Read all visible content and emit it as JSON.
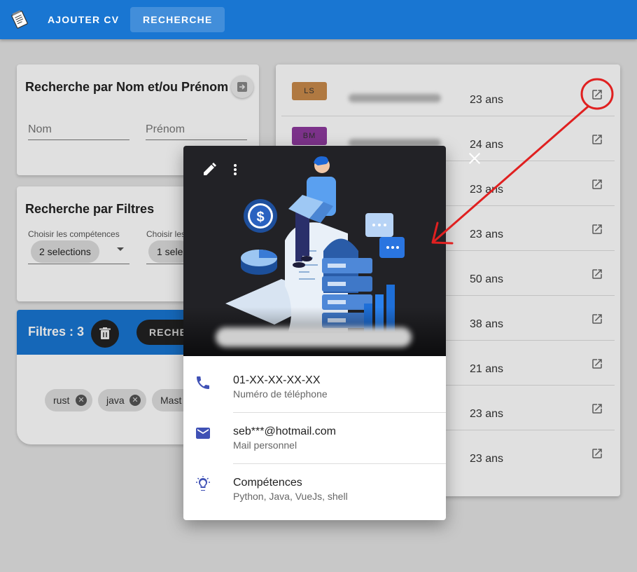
{
  "appbar": {
    "logo_icon": "notepad-icon",
    "nav": [
      {
        "label": "AJOUTER CV"
      },
      {
        "label": "RECHERCHE"
      }
    ]
  },
  "name_search": {
    "title": "Recherche par Nom et/ou Prénom",
    "last_name_label": "Nom",
    "first_name_label": "Prénom",
    "submit_icon": "arrow-right-box-icon"
  },
  "filter_search": {
    "title": "Recherche par Filtres",
    "skills_label": "Choisir les compétences",
    "skills_value": "2 selections",
    "other_label": "Choisir les",
    "other_value": "1 sele"
  },
  "active_filters": {
    "title": "Filtres : 3",
    "reset_label": "RECHE",
    "tags": [
      "rust",
      "java",
      "Mast"
    ]
  },
  "results": [
    {
      "badge": "LS",
      "color": "#c98a4b",
      "age": "23 ans"
    },
    {
      "badge": "BM",
      "color": "#8e3a9e",
      "age": "24 ans"
    },
    {
      "badge": "",
      "color": "#ffffff",
      "age": "23 ans"
    },
    {
      "badge": "",
      "color": "#ffffff",
      "age": "23 ans"
    },
    {
      "badge": "",
      "color": "#ffffff",
      "age": "50 ans"
    },
    {
      "badge": "",
      "color": "#ffffff",
      "age": "38 ans"
    },
    {
      "badge": "",
      "color": "#ffffff",
      "age": "21 ans"
    },
    {
      "badge": "",
      "color": "#ffffff",
      "age": "23 ans"
    },
    {
      "badge": "",
      "color": "#ffffff",
      "age": "23 ans"
    }
  ],
  "modal": {
    "phone": {
      "value": "01-XX-XX-XX-XX",
      "label": "Numéro de téléphone",
      "icon": "phone-icon"
    },
    "mail": {
      "value": "seb***@hotmail.com",
      "label": "Mail personnel",
      "icon": "mail-icon"
    },
    "skills": {
      "value": "Compétences",
      "label": "Python, Java, VueJs, shell",
      "icon": "lightbulb-icon"
    }
  },
  "colors": {
    "primary": "#1976d2",
    "icon_indigo": "#3f51b5",
    "annotation": "#e02020"
  }
}
